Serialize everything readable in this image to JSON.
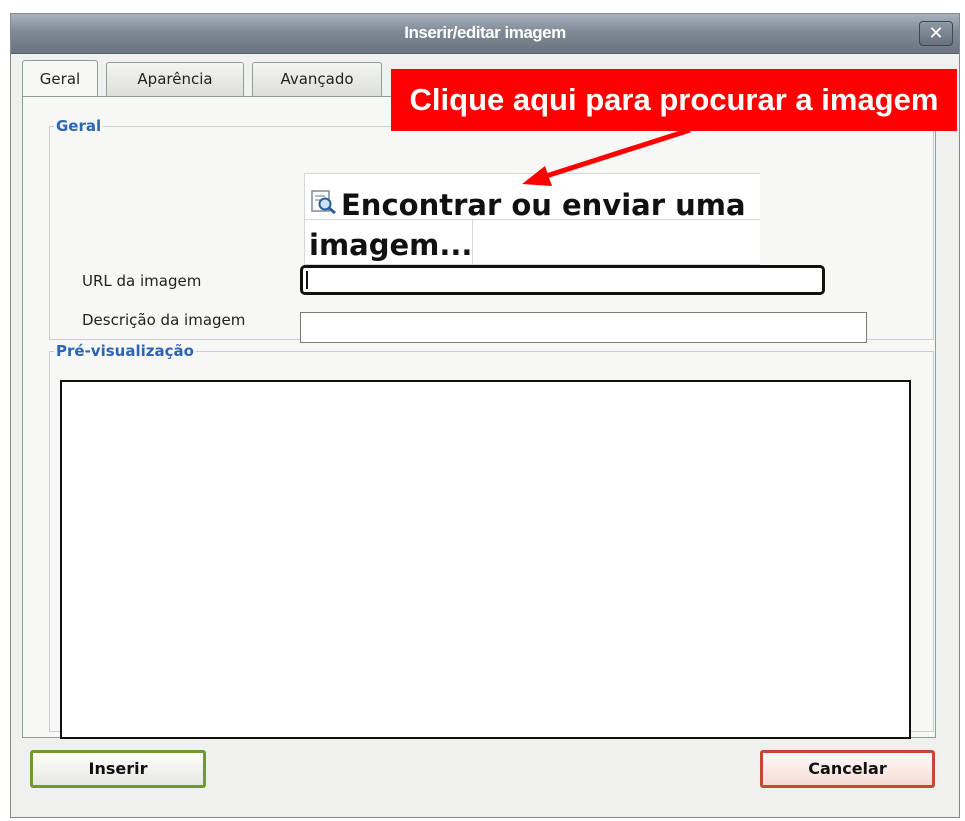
{
  "dialog": {
    "title": "Inserir/editar imagem",
    "close_label": "✕"
  },
  "tabs": [
    {
      "label": "Geral",
      "active": true
    },
    {
      "label": "Aparência",
      "active": false
    },
    {
      "label": "Avançado",
      "active": false
    }
  ],
  "general": {
    "legend": "Geral",
    "find_link": "Encontrar ou enviar uma imagem...",
    "url_label": "URL da imagem",
    "url_value": "",
    "description_label": "Descrição da imagem",
    "description_value": ""
  },
  "preview": {
    "legend": "Pré-visualização"
  },
  "buttons": {
    "insert": "Inserir",
    "cancel": "Cancelar"
  },
  "annotation": {
    "text": "Clique aqui para procurar a imagem",
    "color": "#ff0000"
  },
  "colors": {
    "legend": "#2b65b3",
    "insert_border": "#6f9a2c",
    "cancel_border": "#c24a33"
  }
}
